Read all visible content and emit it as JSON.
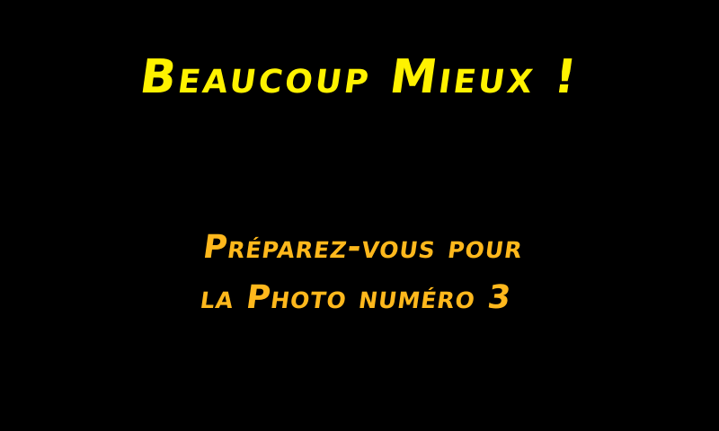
{
  "screen": {
    "title": "Beaucoup Mieux !",
    "message_line_1": "Préparez-vous pour",
    "message_line_2": "la Photo numéro 3"
  },
  "colors": {
    "background": "#000000",
    "title": "#FFF200",
    "message": "#FFB81C"
  }
}
